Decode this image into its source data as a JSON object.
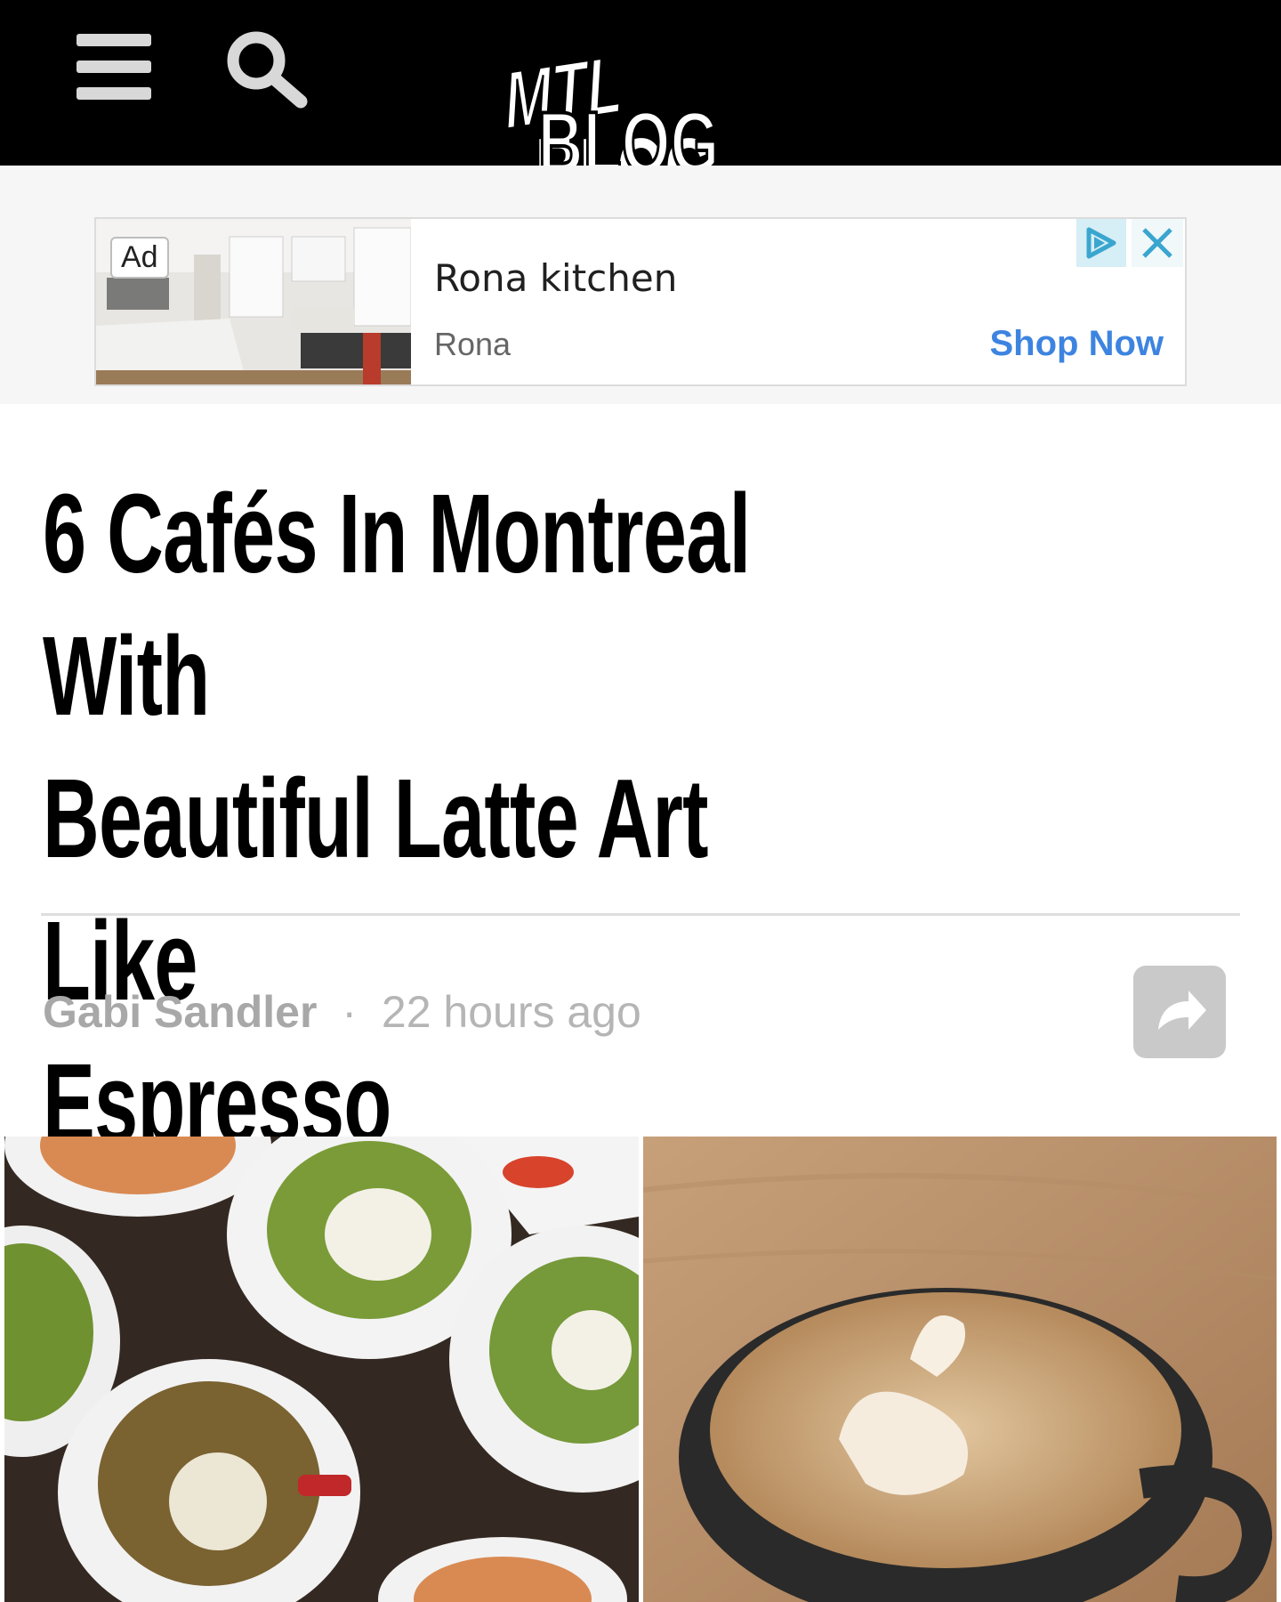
{
  "header": {
    "logo_text_top": "MTL",
    "logo_text_bottom": "BLOG",
    "menu_icon": "hamburger-menu-icon",
    "search_icon": "search-icon"
  },
  "ad": {
    "badge": "Ad",
    "title": "Rona kitchen",
    "advertiser": "Rona",
    "cta": "Shop Now",
    "adchoices_icon": "adchoices-icon",
    "close_icon": "close-icon",
    "cta_color": "#3d84e0"
  },
  "article": {
    "headline_lines": [
      "6 Cafés In Montreal With",
      "Beautiful Latte Art Like",
      "Espresso Masterpieces"
    ],
    "author": "Gabi Sandler",
    "separator": "·",
    "time": "22 hours ago",
    "share_icon": "share-arrow-icon"
  }
}
